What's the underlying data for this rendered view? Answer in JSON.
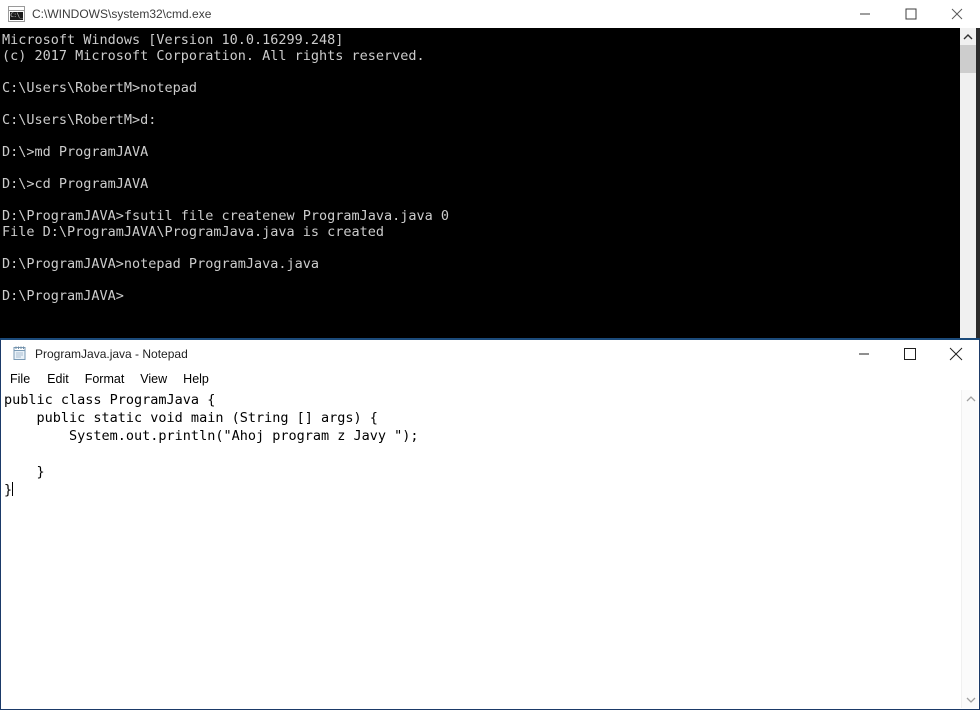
{
  "cmd_window": {
    "title": "C:\\WINDOWS\\system32\\cmd.exe",
    "icon": "cmd-prompt-icon",
    "icon_glyph": "C:\\_",
    "controls": {
      "minimize": "minimize-button",
      "maximize": "maximize-button",
      "close": "close-button"
    },
    "console_text": "Microsoft Windows [Version 10.0.16299.248]\n(c) 2017 Microsoft Corporation. All rights reserved.\n\nC:\\Users\\RobertM>notepad\n\nC:\\Users\\RobertM>d:\n\nD:\\>md ProgramJAVA\n\nD:\\>cd ProgramJAVA\n\nD:\\ProgramJAVA>fsutil file createnew ProgramJava.java 0\nFile D:\\ProgramJAVA\\ProgramJava.java is created\n\nD:\\ProgramJAVA>notepad ProgramJava.java\n\nD:\\ProgramJAVA>",
    "background_color": "#000000",
    "text_color": "#cccccc"
  },
  "notepad_window": {
    "title": "ProgramJava.java - Notepad",
    "icon": "notepad-icon",
    "controls": {
      "minimize": "minimize-button",
      "maximize": "maximize-button",
      "close": "close-button"
    },
    "menu": [
      {
        "label": "File"
      },
      {
        "label": "Edit"
      },
      {
        "label": "Format"
      },
      {
        "label": "View"
      },
      {
        "label": "Help"
      }
    ],
    "document_text": "public class ProgramJava {\n    public static void main (String [] args) {\n        System.out.println(\"Ahoj program z Javy \");\n\n    }\n}",
    "border_color": "#1b3a69",
    "background_color": "#ffffff",
    "text_color": "#000000"
  }
}
